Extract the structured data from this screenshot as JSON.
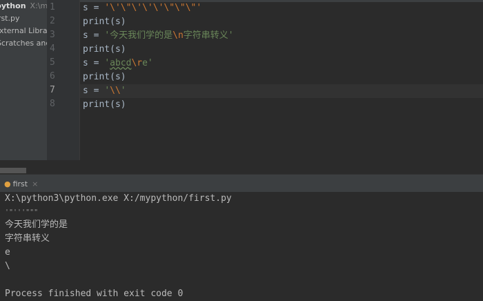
{
  "sidebar": {
    "project": "python",
    "project_path": "X:\\my",
    "items": [
      "first.py",
      "External Libraries",
      "Scratches and Consoles"
    ]
  },
  "editor": {
    "current_line": 7,
    "lines": [
      {
        "n": "1",
        "a": "s = ",
        "s": "'\\'\\\"\\'\\'\\'\\\"\\\"\\\"'"
      },
      {
        "n": "2",
        "code": "print(s)"
      },
      {
        "n": "3",
        "a": "s = ",
        "s1": "'今天我们学的是",
        "e": "\\n",
        "s2": "字符串转义'"
      },
      {
        "n": "4",
        "code": "print(s)"
      },
      {
        "n": "5",
        "a": "s = ",
        "s1": "'",
        "sq": "abcd",
        "e": "\\r",
        "s2": "e'"
      },
      {
        "n": "6",
        "code": "print(s)"
      },
      {
        "n": "7",
        "a": "s = ",
        "s1": "'",
        "e": "\\\\",
        "s2": "'"
      },
      {
        "n": "8",
        "code": "print(s)"
      }
    ]
  },
  "run": {
    "tab_label": "first",
    "close": "×"
  },
  "console": {
    "lines": [
      "X:\\python3\\python.exe X:/mypython/first.py",
      "'\"'''\"\"\"",
      "今天我们学的是",
      "字符串转义",
      "e",
      "\\",
      "",
      "Process finished with exit code 0"
    ]
  }
}
